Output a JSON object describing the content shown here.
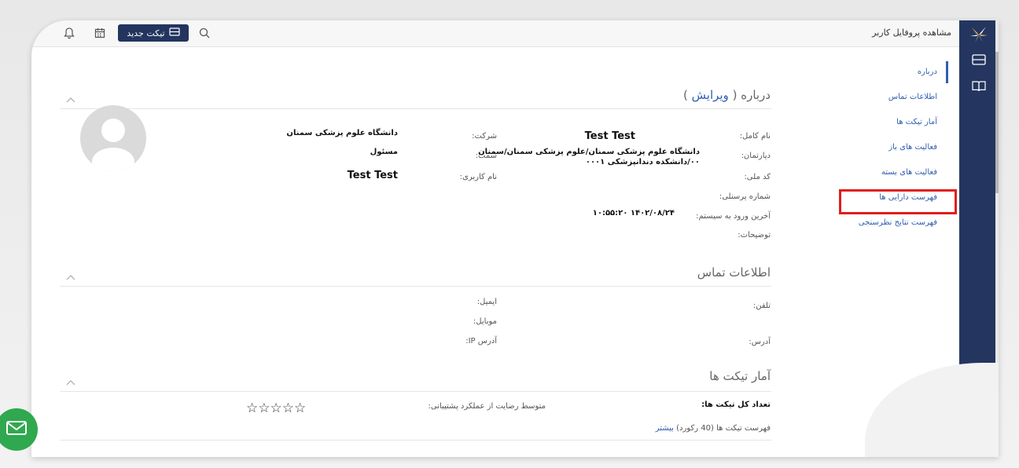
{
  "header": {
    "page_title": "مشاهده پروفایل کاربر",
    "new_ticket_label": "تیکت جدید",
    "icons": [
      "search-icon",
      "calendar-icon",
      "bell-icon"
    ]
  },
  "sidebar": {
    "items": [
      {
        "label": "درباره",
        "active": true
      },
      {
        "label": "اطلاعات تماس"
      },
      {
        "label": "آمار تیکت ها"
      },
      {
        "label": "فعالیت های باز"
      },
      {
        "label": "فعالیت های بسته"
      },
      {
        "label": "فهرست دارایی ها",
        "highlighted": true
      },
      {
        "label": "فهرست نتایج نظرسنجی"
      }
    ]
  },
  "about": {
    "title": "درباره (",
    "edit_label": "ویرایش",
    "title_close": ")",
    "full_name_label": "نام کامل:",
    "full_name": "Test Test",
    "department_label": "دپارتمان:",
    "department_line1": "دانشگاه علوم پزشکی سمنان/علوم پزشکی سمنان/سمنان",
    "department_line2": "۰۰/دانشکده دندانپزشکی ۰۰۰۱",
    "national_id_label": "کد ملی:",
    "personnel_no_label": "شماره پرسنلی:",
    "last_login_label": "آخرین ورود به سیستم:",
    "last_login": "۱۴۰۲/۰۸/۲۴ ۱۰:۵۵:۲۰",
    "notes_label": "توضیحات:",
    "company_label": "شرکت:",
    "company": "دانشگاه علوم پزشکی سمنان",
    "position_label": "سمت:",
    "position": "مسئول",
    "username_label": "نام کاربری:",
    "username": "Test Test"
  },
  "contact": {
    "title": "اطلاعات تماس",
    "phone_label": "تلفن:",
    "address_label": "آدرس:",
    "email_label": "ایمیل:",
    "mobile_label": "موبایل:",
    "ip_label": "آدرس IP:"
  },
  "tickets": {
    "title": "آمار تیکت ها",
    "total_label": "تعداد کل تیکت ها:",
    "satisfaction_label": "متوسط رضایت از عملکرد پشتیبانی:",
    "list_text": "فهرست تیکت ها (40 رکورد)",
    "more_label": "بیشتر",
    "rating": 0,
    "stars": "☆☆☆☆☆"
  },
  "colors": {
    "rail": "#24365f",
    "accent": "#2f5fb0",
    "highlight": "#e11d1d",
    "fab": "#2fa84f"
  }
}
